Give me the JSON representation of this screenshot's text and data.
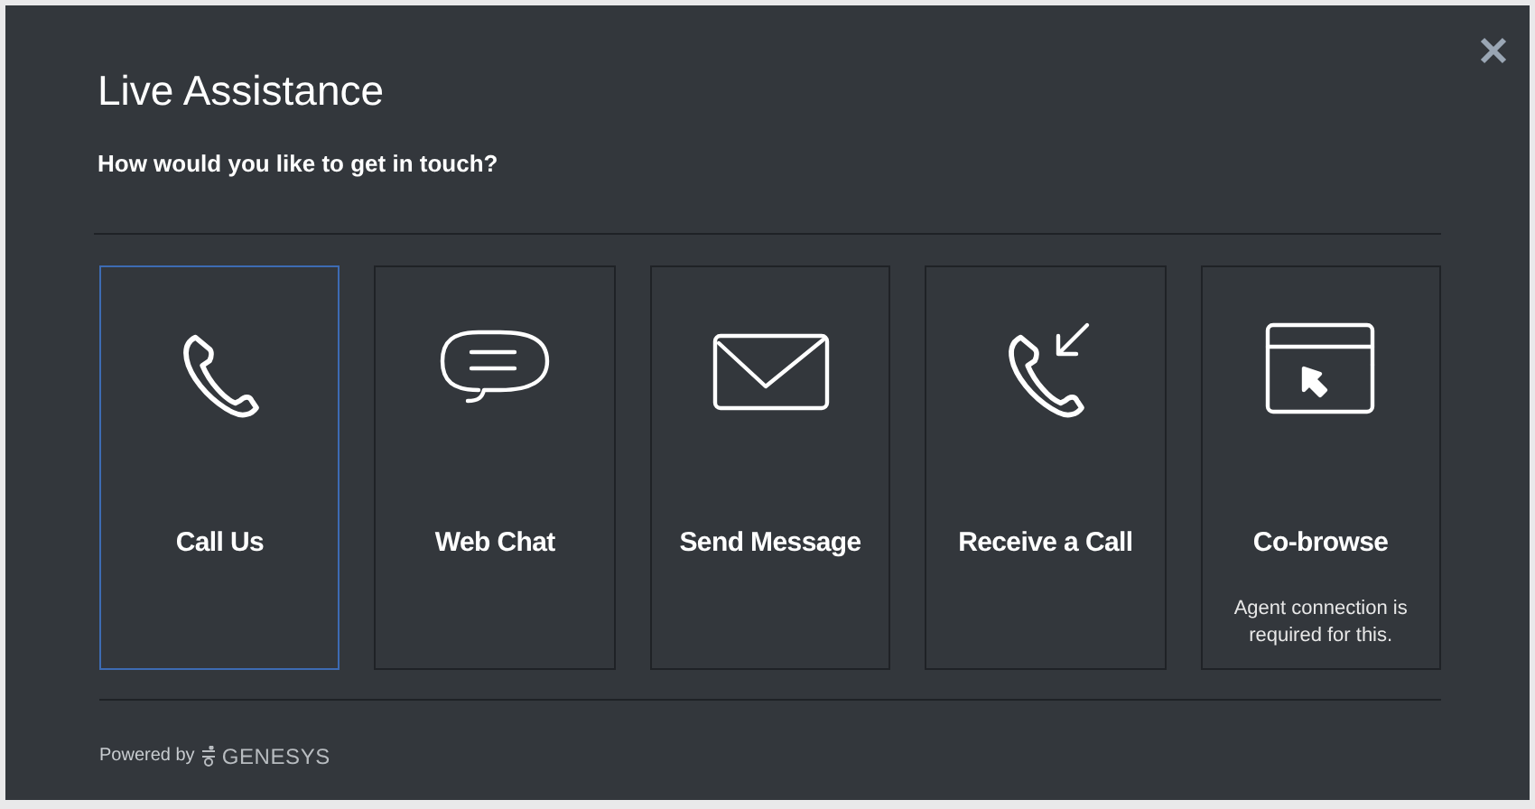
{
  "dialog": {
    "title": "Live Assistance",
    "prompt": "How would you like to get in touch?"
  },
  "options": [
    {
      "label": "Call Us",
      "kind": "phone",
      "selected": true
    },
    {
      "label": "Web Chat",
      "kind": "chat",
      "selected": false
    },
    {
      "label": "Send Message",
      "kind": "mail",
      "selected": false
    },
    {
      "label": "Receive a Call",
      "kind": "incoming",
      "selected": false
    },
    {
      "label": "Co-browse",
      "kind": "cobrowse",
      "selected": false,
      "note": "Agent connection is required for this."
    }
  ],
  "footer": {
    "powered_by": "Powered by",
    "brand": "GENESYS"
  }
}
